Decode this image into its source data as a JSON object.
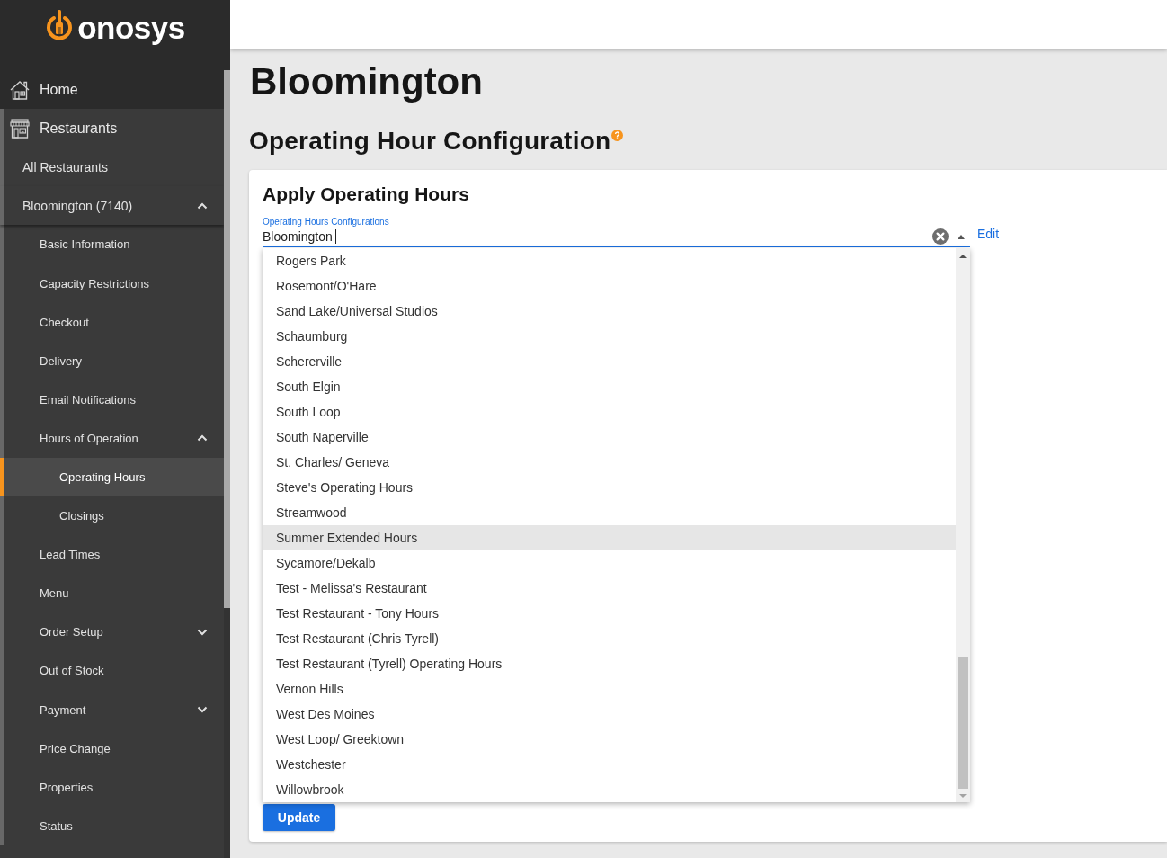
{
  "logo": {
    "text": "onosys"
  },
  "sidebar": {
    "items": [
      {
        "label": "Home",
        "selected": false
      },
      {
        "label": "Restaurants",
        "selected": false,
        "children": [
          {
            "label": "All Restaurants",
            "selected": false
          },
          {
            "label": "Bloomington (7140)",
            "selected": false,
            "expanded": true,
            "children": [
              {
                "label": "Basic Information",
                "selected": false
              },
              {
                "label": "Capacity Restrictions",
                "selected": false
              },
              {
                "label": "Checkout",
                "selected": false
              },
              {
                "label": "Delivery",
                "selected": false
              },
              {
                "label": "Email Notifications",
                "selected": false
              },
              {
                "label": "Hours of Operation",
                "selected": false,
                "expanded": true,
                "children": [
                  {
                    "label": "Operating Hours",
                    "selected": true
                  },
                  {
                    "label": "Closings",
                    "selected": false
                  }
                ]
              },
              {
                "label": "Lead Times",
                "selected": false
              },
              {
                "label": "Menu",
                "selected": false
              },
              {
                "label": "Order Setup",
                "selected": false,
                "expanded": false
              },
              {
                "label": "Out of Stock",
                "selected": false
              },
              {
                "label": "Payment",
                "selected": false,
                "expanded": false
              },
              {
                "label": "Price Change",
                "selected": false
              },
              {
                "label": "Properties",
                "selected": false
              },
              {
                "label": "Status",
                "selected": false
              }
            ]
          }
        ]
      }
    ]
  },
  "page": {
    "title": "Bloomington",
    "subtitle": "Operating Hour Configuration"
  },
  "card": {
    "title": "Apply Operating Hours",
    "field": {
      "label": "Operating Hours Configurations",
      "value": "Bloomington",
      "focused": true
    },
    "edit_link": "Edit",
    "dropdown": {
      "open": true,
      "options": [
        {
          "label": "Rogers Park",
          "selected": false
        },
        {
          "label": "Rosemont/O'Hare",
          "selected": false
        },
        {
          "label": "Sand Lake/Universal Studios",
          "selected": false
        },
        {
          "label": "Schaumburg",
          "selected": false
        },
        {
          "label": "Schererville",
          "selected": false
        },
        {
          "label": "South Elgin",
          "selected": false
        },
        {
          "label": "South Loop",
          "selected": false
        },
        {
          "label": "South Naperville",
          "selected": false
        },
        {
          "label": "St. Charles/ Geneva",
          "selected": false
        },
        {
          "label": "Steve's Operating Hours",
          "selected": false
        },
        {
          "label": "Streamwood",
          "selected": false
        },
        {
          "label": "Summer Extended Hours",
          "selected": true
        },
        {
          "label": "Sycamore/Dekalb",
          "selected": false
        },
        {
          "label": "Test - Melissa's Restaurant",
          "selected": false
        },
        {
          "label": "Test Restaurant - Tony Hours",
          "selected": false
        },
        {
          "label": "Test Restaurant (Chris Tyrell)",
          "selected": false
        },
        {
          "label": "Test Restaurant (Tyrell) Operating Hours",
          "selected": false
        },
        {
          "label": "Vernon Hills",
          "selected": false
        },
        {
          "label": "West Des Moines",
          "selected": false
        },
        {
          "label": "West Loop/ Greektown",
          "selected": false
        },
        {
          "label": "Westchester",
          "selected": false
        },
        {
          "label": "Willowbrook",
          "selected": false
        }
      ]
    },
    "button": "Update"
  }
}
